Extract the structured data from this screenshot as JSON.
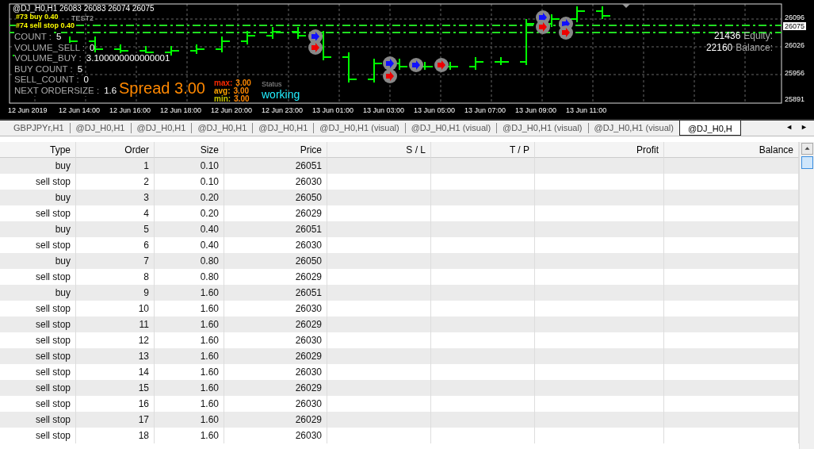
{
  "chart": {
    "header": "@DJ_H0,H1  26083 26083 26074 26075",
    "order_labels": [
      "#73 buy 0.40",
      "#74 sell stop 0.40"
    ],
    "overlay_label": "TEST2",
    "info_lines": [
      {
        "label": "COUNT :",
        "value": "5"
      },
      {
        "label": "VOLUME_SELL :",
        "value": "0"
      },
      {
        "label": "VOLUME_BUY :",
        "value": "3.100000000000001"
      },
      {
        "label": "BUY COUNT :",
        "value": "5"
      },
      {
        "label": "SELL_COUNT :",
        "value": "0"
      },
      {
        "label": "NEXT ORDERSIZE :",
        "value": "1.6"
      }
    ],
    "spread": "Spread 3.00",
    "stats": [
      {
        "label": "max:",
        "value": "3.00",
        "color": "#ff2a00"
      },
      {
        "label": "avg:",
        "value": "3.00",
        "color": "#ffa500"
      },
      {
        "label": "min:",
        "value": "3.00",
        "color": "#c8c800"
      }
    ],
    "status_label": "Status",
    "status_value": "working",
    "account": [
      {
        "value": "21436",
        "label": "Equity:"
      },
      {
        "value": "22160",
        "label": "Balance:"
      }
    ],
    "price_labels": [
      {
        "text": "26096",
        "current": false
      },
      {
        "text": "26075",
        "current": true
      },
      {
        "text": "26026",
        "current": false
      },
      {
        "text": "25956",
        "current": false
      },
      {
        "text": "25891",
        "current": false
      }
    ],
    "time_labels": [
      "12 Jun 2019",
      "12 Jun 14:00",
      "12 Jun 16:00",
      "12 Jun 18:00",
      "12 Jun 20:00",
      "12 Jun 23:00",
      "13 Jun 01:00",
      "13 Jun 03:00",
      "13 Jun 05:00",
      "13 Jun 07:00",
      "13 Jun 09:00",
      "13 Jun 11:00"
    ]
  },
  "tabs": [
    {
      "label": "GBPJPYr,H1",
      "selected": false
    },
    {
      "label": "@DJ_H0,H1",
      "selected": false
    },
    {
      "label": "@DJ_H0,H1",
      "selected": false
    },
    {
      "label": "@DJ_H0,H1",
      "selected": false
    },
    {
      "label": "@DJ_H0,H1",
      "selected": false
    },
    {
      "label": "@DJ_H0,H1 (visual)",
      "selected": false
    },
    {
      "label": "@DJ_H0,H1 (visual)",
      "selected": false
    },
    {
      "label": "@DJ_H0,H1 (visual)",
      "selected": false
    },
    {
      "label": "@DJ_H0,H1 (visual)",
      "selected": false
    },
    {
      "label": "@DJ_H0,H",
      "selected": true
    }
  ],
  "tab_arrows": [
    "◄",
    "►"
  ],
  "table": {
    "columns": [
      "Type",
      "Order",
      "Size",
      "Price",
      "S / L",
      "T / P",
      "Profit",
      "Balance"
    ],
    "rows": [
      [
        "buy",
        "1",
        "0.10",
        "26051"
      ],
      [
        "sell stop",
        "2",
        "0.10",
        "26030"
      ],
      [
        "buy",
        "3",
        "0.20",
        "26050"
      ],
      [
        "sell stop",
        "4",
        "0.20",
        "26029"
      ],
      [
        "buy",
        "5",
        "0.40",
        "26051"
      ],
      [
        "sell stop",
        "6",
        "0.40",
        "26030"
      ],
      [
        "buy",
        "7",
        "0.80",
        "26050"
      ],
      [
        "sell stop",
        "8",
        "0.80",
        "26029"
      ],
      [
        "buy",
        "9",
        "1.60",
        "26051"
      ],
      [
        "sell stop",
        "10",
        "1.60",
        "26030"
      ],
      [
        "sell stop",
        "11",
        "1.60",
        "26029"
      ],
      [
        "sell stop",
        "12",
        "1.60",
        "26030"
      ],
      [
        "sell stop",
        "13",
        "1.60",
        "26029"
      ],
      [
        "sell stop",
        "14",
        "1.60",
        "26030"
      ],
      [
        "sell stop",
        "15",
        "1.60",
        "26029"
      ],
      [
        "sell stop",
        "16",
        "1.60",
        "26030"
      ],
      [
        "sell stop",
        "17",
        "1.60",
        "26029"
      ],
      [
        "sell stop",
        "18",
        "1.60",
        "26030"
      ]
    ]
  }
}
